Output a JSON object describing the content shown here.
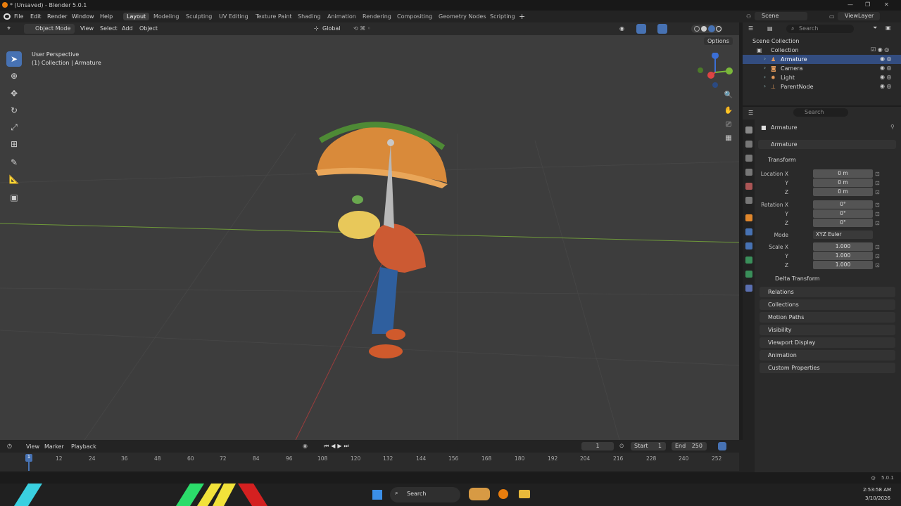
{
  "app": {
    "title": "* (Unsaved) - Blender 5.0.1"
  },
  "menu": {
    "items": [
      "File",
      "Edit",
      "Render",
      "Window",
      "Help"
    ]
  },
  "workspaces": [
    "Layout",
    "Modeling",
    "Sculpting",
    "UV Editing",
    "Texture Paint",
    "Shading",
    "Animation",
    "Rendering",
    "Compositing",
    "Geometry Nodes",
    "Scripting"
  ],
  "scene": {
    "label": "Scene",
    "view_layer": "ViewLayer"
  },
  "viewport": {
    "mode": "Object Mode",
    "menus": [
      "View",
      "Select",
      "Add",
      "Object"
    ],
    "orientation": "Global",
    "options": "Options",
    "overlay_title": "User Perspective",
    "overlay_sub": "(1) Collection | Armature"
  },
  "outliner": {
    "search_placeholder": "Search",
    "rows": [
      {
        "label": "Scene Collection"
      },
      {
        "label": "Collection"
      },
      {
        "label": "Armature"
      },
      {
        "label": "Camera"
      },
      {
        "label": "Light"
      },
      {
        "label": "ParentNode"
      }
    ]
  },
  "properties": {
    "search_placeholder": "Search",
    "object_name": "Armature",
    "data_name": "Armature",
    "transform": {
      "title": "Transform",
      "location_label": "Location X",
      "rotation_label": "Rotation X",
      "scale_label": "Scale X",
      "y": "Y",
      "z": "Z",
      "loc": [
        "0 m",
        "0 m",
        "0 m"
      ],
      "rot": [
        "0°",
        "0°",
        "0°"
      ],
      "mode_label": "Mode",
      "mode": "XYZ Euler",
      "scale": [
        "1.000",
        "1.000",
        "1.000"
      ],
      "delta": "Delta Transform"
    },
    "panels": [
      "Relations",
      "Collections",
      "Motion Paths",
      "Visibility",
      "Viewport Display",
      "Animation",
      "Custom Properties"
    ]
  },
  "timeline": {
    "menus": [
      "View",
      "Marker",
      "Playback"
    ],
    "current_frame": "1",
    "start_label": "Start",
    "start": "1",
    "end_label": "End",
    "end": "250",
    "ticks": [
      "12",
      "24",
      "36",
      "48",
      "60",
      "72",
      "84",
      "96",
      "108",
      "120",
      "132",
      "144",
      "156",
      "168",
      "180",
      "192",
      "204",
      "216",
      "228",
      "240",
      "252"
    ],
    "playhead": "1"
  },
  "status": {
    "version": "5.0.1"
  },
  "taskbar": {
    "search": "Search",
    "time": "2:53:58 AM",
    "date": "3/10/2026"
  },
  "colors": {
    "accent": "#4772b3",
    "selection": "#334d80",
    "viewport": "#3d3d3d"
  }
}
